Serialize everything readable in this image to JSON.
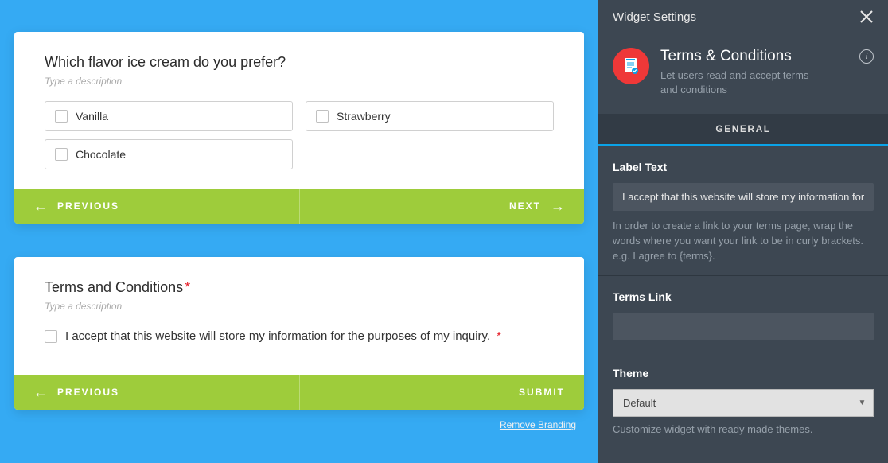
{
  "form1": {
    "question": "Which flavor ice cream do you prefer?",
    "desc_placeholder": "Type a description",
    "options": [
      "Vanilla",
      "Strawberry",
      "Chocolate"
    ],
    "prev": "PREVIOUS",
    "next": "NEXT"
  },
  "form2": {
    "title": "Terms and Conditions",
    "required_mark": "*",
    "desc_placeholder": "Type a description",
    "accept_text": "I accept that this website will store my information for the purposes of my inquiry.",
    "prev": "PREVIOUS",
    "submit": "SUBMIT"
  },
  "remove_branding": "Remove Branding",
  "sidebar": {
    "header": "Widget Settings",
    "widget_title": "Terms & Conditions",
    "widget_desc": "Let users read and accept terms and conditions",
    "tab_general": "GENERAL",
    "label_text": {
      "label": "Label Text",
      "value": "I accept that this website will store my information for",
      "help": "In order to create a link to your terms page, wrap the words where you want your link to be in curly brackets. e.g. I agree to {terms}."
    },
    "terms_link": {
      "label": "Terms Link",
      "value": ""
    },
    "theme": {
      "label": "Theme",
      "selected": "Default",
      "help": "Customize widget with ready made themes."
    }
  }
}
